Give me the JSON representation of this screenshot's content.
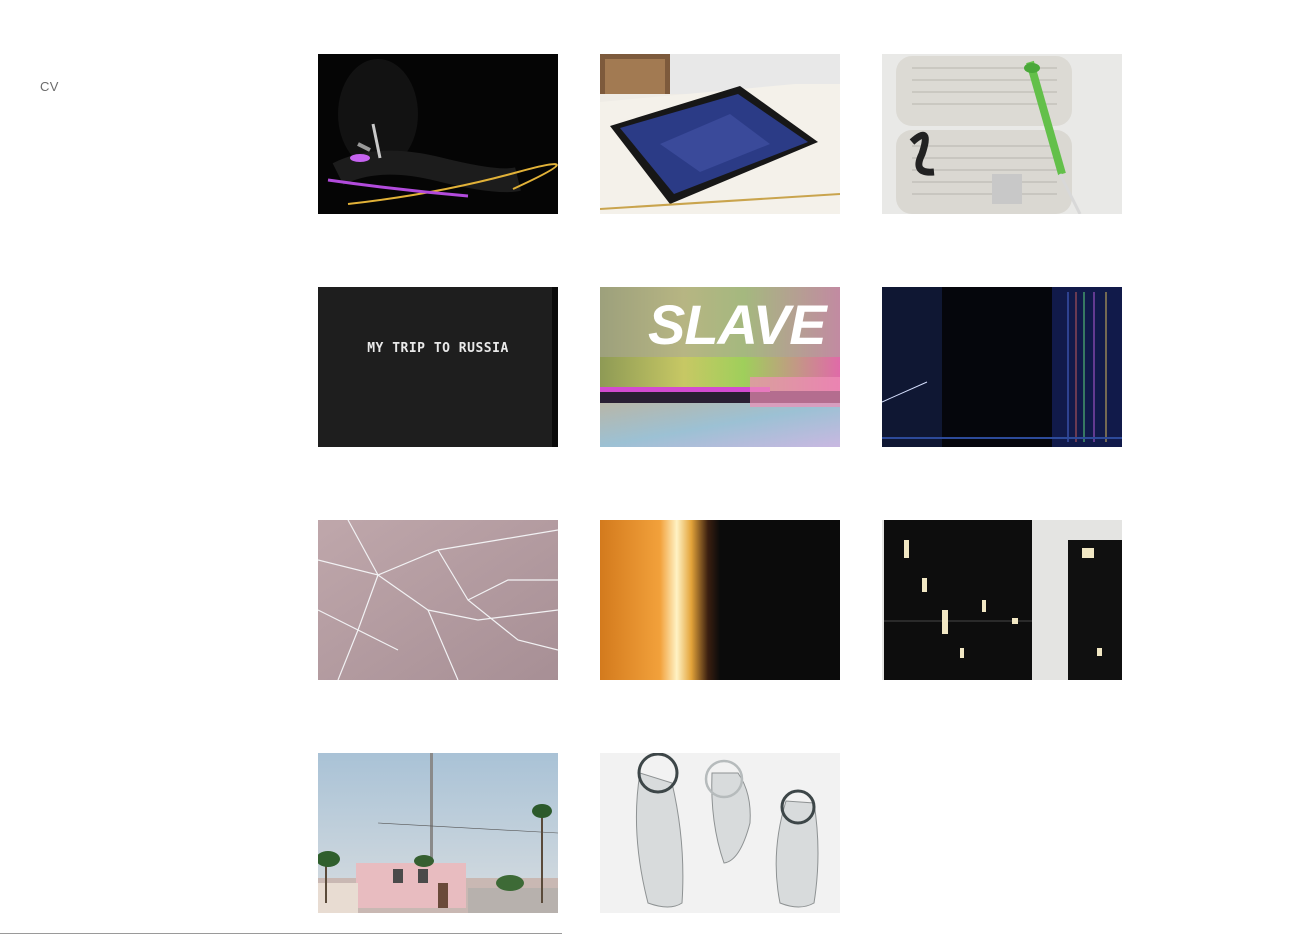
{
  "nav": {
    "cv_label": "CV"
  },
  "thumbnails": [
    {
      "icon": "dark-performance-image"
    },
    {
      "icon": "tablet-on-book-image"
    },
    {
      "icon": "spray-painted-fan-image"
    },
    {
      "icon": "video-title-card-image",
      "caption": "MY TRIP TO RUSSIA"
    },
    {
      "icon": "glitch-video-still-image",
      "caption": "SLAVE"
    },
    {
      "icon": "broken-screen-image"
    },
    {
      "icon": "cracked-glass-image"
    },
    {
      "icon": "light-leak-image"
    },
    {
      "icon": "black-panels-image"
    },
    {
      "icon": "street-with-palms-image"
    },
    {
      "icon": "condoms-on-white-image"
    }
  ],
  "colors": {
    "background": "#ffffff",
    "nav_text": "#6b6b6b",
    "rule": "#9a9a9a"
  }
}
